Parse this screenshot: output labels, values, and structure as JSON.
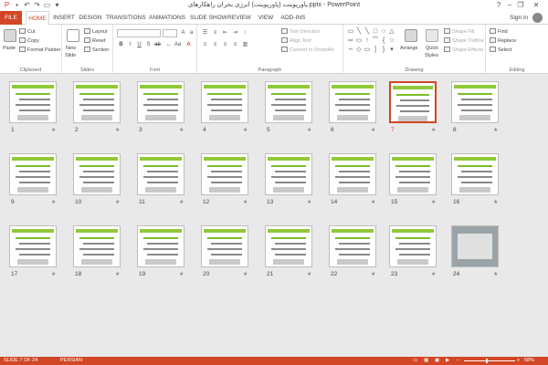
{
  "window": {
    "title": "پاورپوینت (پاورپوینت) انرژی بحران راهکارهای.pptx - PowerPoint"
  },
  "tabs": [
    "HOME",
    "INSERT",
    "DESIGN",
    "TRANSITIONS",
    "ANIMATIONS",
    "SLIDE SHOW",
    "REVIEW",
    "VIEW",
    "ADD-INS"
  ],
  "file_tab": "FILE",
  "sign_in": "Sign in",
  "ribbon": {
    "clipboard": {
      "label": "Clipboard",
      "paste": "Paste",
      "cut": "Cut",
      "copy": "Copy",
      "format_painter": "Format Painter"
    },
    "slides": {
      "label": "Slides",
      "new_slide": "New",
      "new_slide_2": "Slide",
      "layout": "Layout",
      "reset": "Reset",
      "section": "Section"
    },
    "font": {
      "label": "Font"
    },
    "paragraph": {
      "label": "Paragraph",
      "text_direction": "Text Direction",
      "align_text": "Align Text",
      "convert": "Convert to SmartArt"
    },
    "drawing": {
      "label": "Drawing",
      "arrange": "Arrange",
      "quick_styles": "Quick",
      "quick_styles_2": "Styles",
      "shape_fill": "Shape Fill",
      "shape_outline": "Shape Outline",
      "shape_effects": "Shape Effects"
    },
    "editing": {
      "label": "Editing",
      "find": "Find",
      "replace": "Replace",
      "select": "Select"
    }
  },
  "slides": [
    {
      "n": "1"
    },
    {
      "n": "2"
    },
    {
      "n": "3"
    },
    {
      "n": "4"
    },
    {
      "n": "5"
    },
    {
      "n": "6"
    },
    {
      "n": "7"
    },
    {
      "n": "8"
    },
    {
      "n": "9"
    },
    {
      "n": "10"
    },
    {
      "n": "11"
    },
    {
      "n": "12"
    },
    {
      "n": "13"
    },
    {
      "n": "14"
    },
    {
      "n": "15"
    },
    {
      "n": "16"
    },
    {
      "n": "17"
    },
    {
      "n": "18"
    },
    {
      "n": "19"
    },
    {
      "n": "20"
    },
    {
      "n": "21"
    },
    {
      "n": "22"
    },
    {
      "n": "23"
    },
    {
      "n": "24"
    }
  ],
  "selected_slide": 7,
  "status": {
    "slide_of": "SLIDE 7 OF 24",
    "language": "PERSIAN",
    "zoom": "58%"
  },
  "colors": {
    "accent": "#d24726",
    "slide_green": "#8fc93a"
  }
}
